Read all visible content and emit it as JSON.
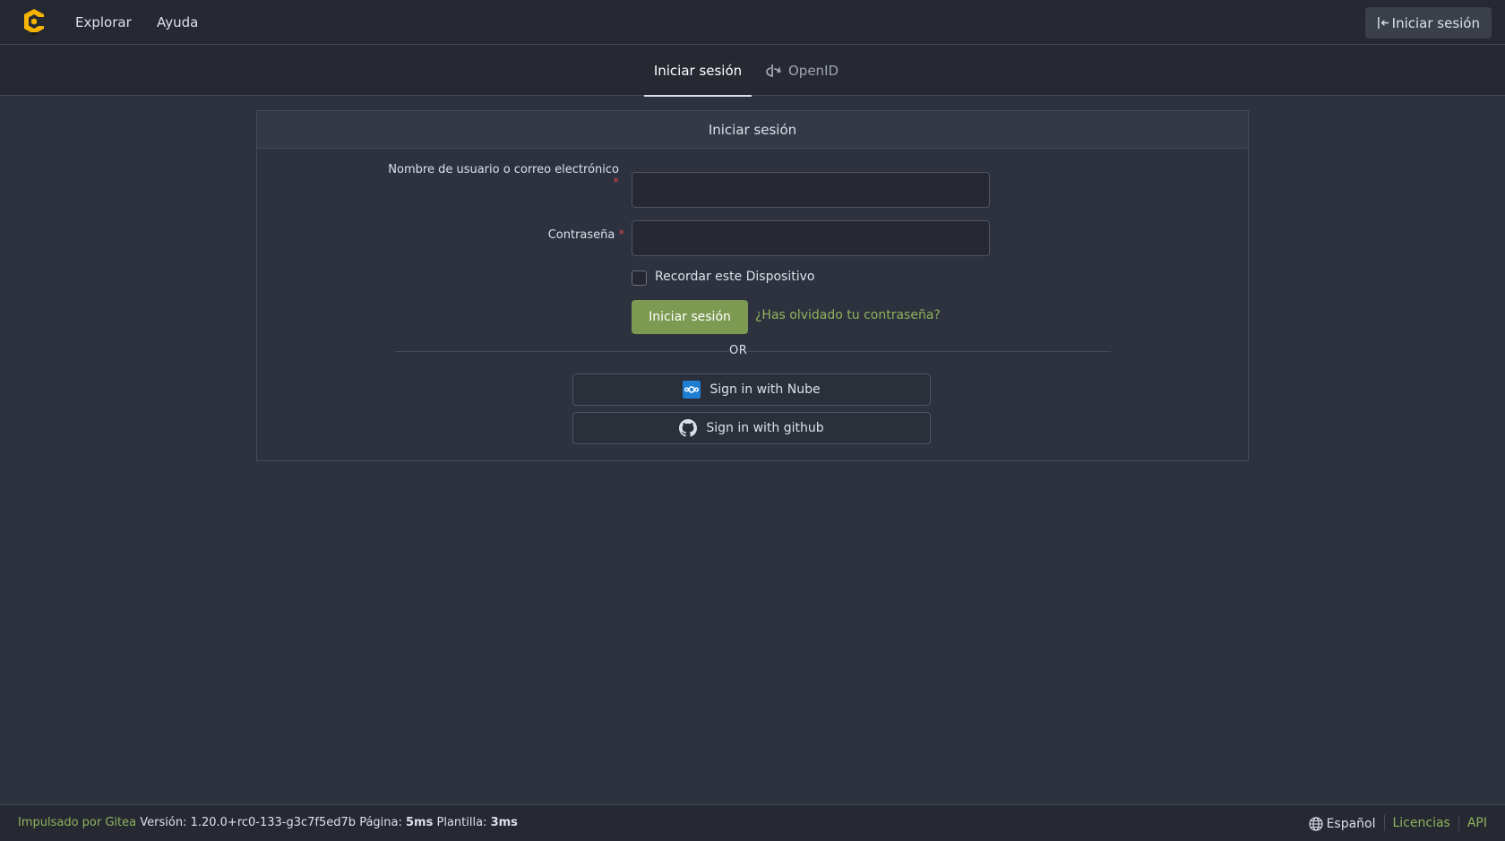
{
  "nav": {
    "logo_icon": "gitea-logo-icon",
    "explore": "Explorar",
    "help": "Ayuda",
    "signin": "Iniciar sesión",
    "signin_icon": "sign-in-icon"
  },
  "tabs": {
    "signin": "Iniciar sesión",
    "openid": "OpenID",
    "openid_icon": "openid-icon"
  },
  "form": {
    "title": "Iniciar sesión",
    "username_label": "Nombre de usuario o correo electrónico",
    "username_value": "",
    "password_label": "Contraseña",
    "password_value": "",
    "required_mark": "*",
    "remember_label": "Recordar este Dispositivo",
    "remember_checked": false,
    "submit": "Iniciar sesión",
    "forgot": "¿Has olvidado tu contraseña?",
    "or": "OR",
    "oauth_nube": "Sign in with Nube",
    "oauth_nube_icon": "nextcloud-icon",
    "oauth_github": "Sign in with github",
    "oauth_github_icon": "github-icon"
  },
  "footer": {
    "powered": "Impulsado por Gitea",
    "version_label": "Versión:",
    "version": "1.20.0+rc0-133-g3c7f5ed7b",
    "page_label": "Página:",
    "page_time": "5ms",
    "template_label": "Plantilla:",
    "template_time": "3ms",
    "language": "Español",
    "language_icon": "globe-icon",
    "licenses": "Licencias",
    "api": "API"
  },
  "colors": {
    "accent": "#7c9a52",
    "link": "#8fb35c",
    "background": "#2e323e",
    "navbar": "#262932",
    "required": "#cc4848",
    "logo": "#f6b400"
  }
}
